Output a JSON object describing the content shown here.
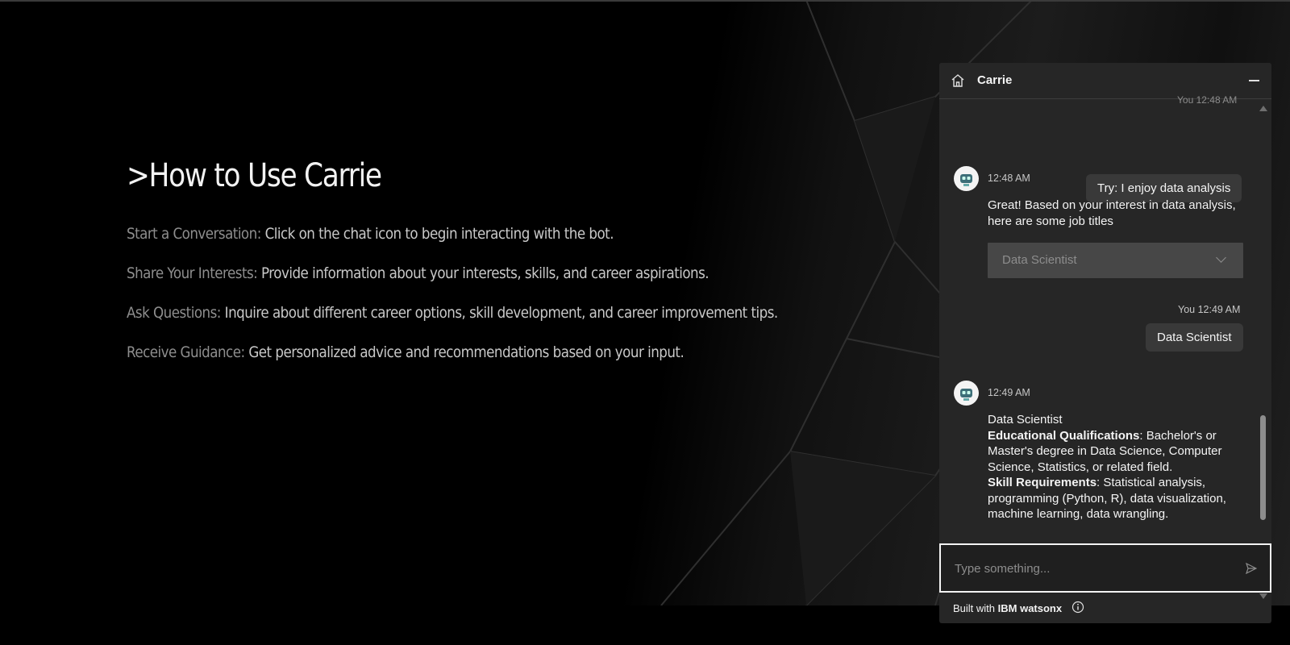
{
  "howto": {
    "title": ">How to Use Carrie",
    "items": [
      {
        "key": "Start a Conversation:",
        "text": " Click on the chat icon to begin interacting with the bot."
      },
      {
        "key": "Share Your Interests:",
        "text": " Provide information about your interests, skills, and career aspirations."
      },
      {
        "key": "Ask Questions:",
        "text": " Inquire about different career options, skill development, and career improvement tips."
      },
      {
        "key": "Receive Guidance:",
        "text": " Get personalized advice and recommendations based on your input."
      }
    ]
  },
  "chat": {
    "title": "Carrie",
    "cut_off_label": "You 12:48 AM",
    "messages": [
      {
        "from": "user",
        "text": "Try: I enjoy data analysis"
      },
      {
        "from": "bot",
        "time": "12:48 AM",
        "text": "Great! Based on your interest in data analysis, here are some job titles",
        "dropdown": {
          "selected": "Data Scientist"
        }
      },
      {
        "from": "user",
        "label": "You 12:49 AM",
        "text": "Data Scientist"
      },
      {
        "from": "bot",
        "time": "12:49 AM",
        "heading": "Data Scientist",
        "lines": [
          {
            "label": "Educational Qualifications",
            "text": ": Bachelor's or Master's degree in Data Science, Computer Science, Statistics, or related field."
          },
          {
            "label": "Skill Requirements",
            "text": ": Statistical analysis, programming (Python, R), data visualization, machine learning, data wrangling."
          }
        ]
      }
    ],
    "input": {
      "placeholder": "Type something..."
    },
    "footer": {
      "prefix": "Built with ",
      "brand": "IBM watsonx"
    }
  },
  "icons": {
    "home": "home-icon",
    "minimize": "minimize-icon",
    "send": "send-icon",
    "info": "info-icon",
    "avatar": "robot-avatar-icon"
  }
}
